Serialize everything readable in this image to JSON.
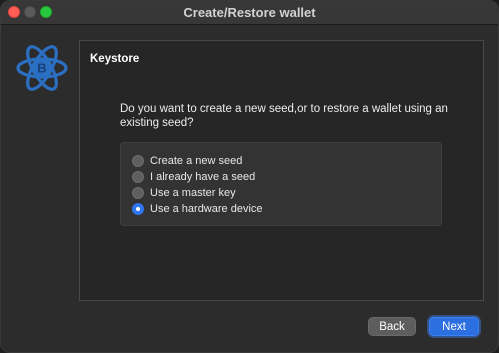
{
  "window": {
    "title": "Create/Restore wallet"
  },
  "logo": {
    "icon": "electrum-bitcoin-atom-logo",
    "color": "#2b6fc2",
    "glyph": "B"
  },
  "panel": {
    "title": "Keystore",
    "question": "Do you want to create a new seed,or to restore a wallet using an existing seed?",
    "options": [
      {
        "label": "Create a new seed",
        "selected": false
      },
      {
        "label": "I already have a seed",
        "selected": false
      },
      {
        "label": "Use a master key",
        "selected": false
      },
      {
        "label": "Use a hardware device",
        "selected": true
      }
    ]
  },
  "buttons": {
    "back": "Back",
    "next": "Next"
  },
  "colors": {
    "accent": "#2f76f0",
    "close": "#ff5f57",
    "maximize": "#28c840"
  }
}
